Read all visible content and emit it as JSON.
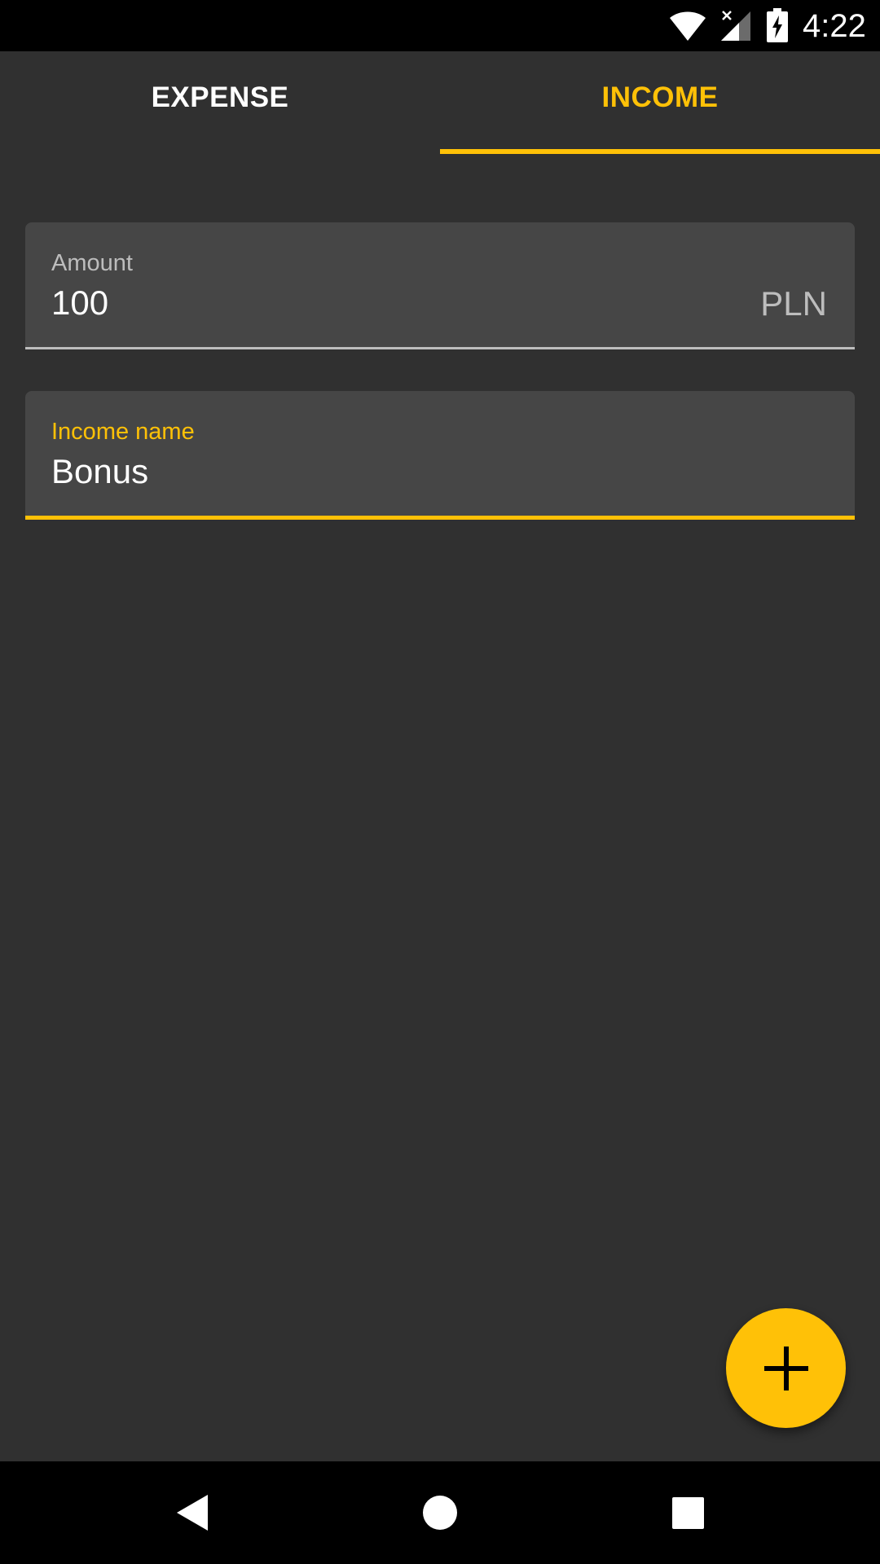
{
  "status_bar": {
    "time": "4:22",
    "icons": [
      "wifi-icon",
      "cell-signal-icon",
      "battery-charging-icon"
    ]
  },
  "tabs": [
    {
      "label": "EXPENSE",
      "active": false
    },
    {
      "label": "INCOME",
      "active": true
    }
  ],
  "form": {
    "amount": {
      "label": "Amount",
      "value": "100",
      "suffix": "PLN"
    },
    "name": {
      "label": "Income name",
      "value": "Bonus",
      "focused": true
    }
  },
  "fab": {
    "icon": "plus-icon"
  },
  "nav_bar": {
    "icons": [
      "back-icon",
      "home-icon",
      "recents-icon"
    ]
  },
  "colors": {
    "accent": "#FFC107",
    "background": "#303030",
    "field_background": "#464646",
    "text_primary": "#FFFFFF",
    "text_secondary": "#BDBDBD"
  }
}
